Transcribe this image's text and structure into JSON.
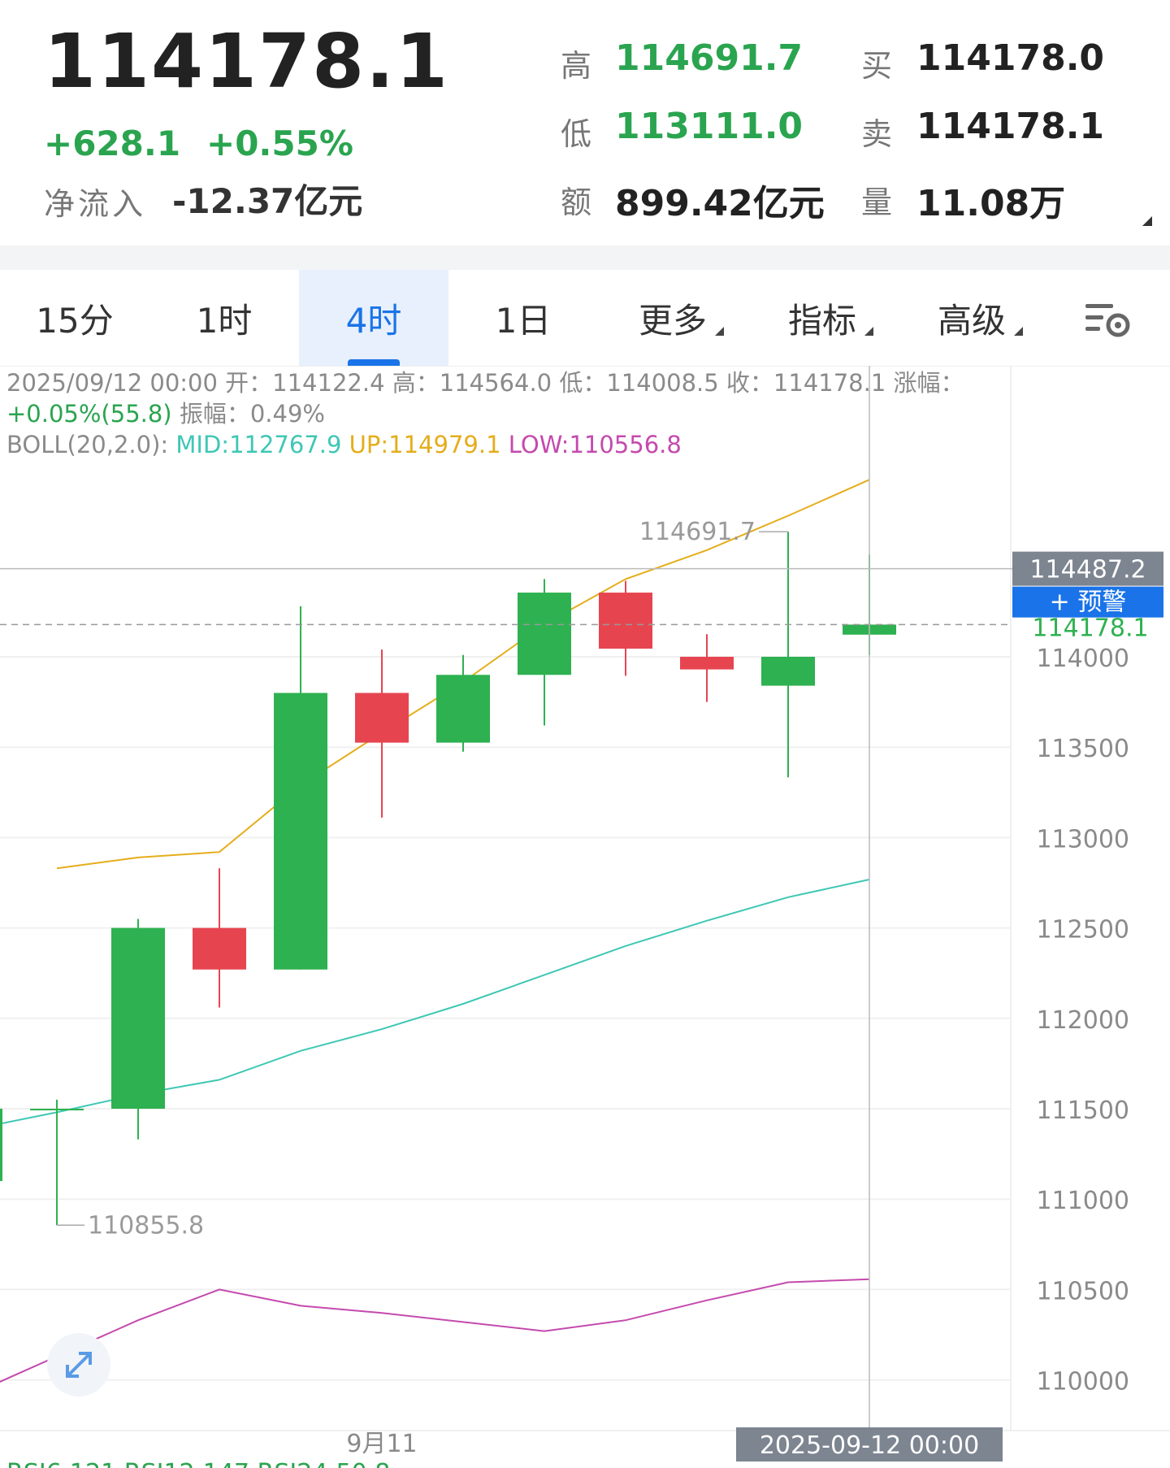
{
  "quote": {
    "price": "114178.1",
    "change": "+628.1",
    "change_pct": "+0.55%",
    "net_inflow_label": "净流入",
    "net_inflow_value": "-12.37亿元",
    "high_label": "高",
    "high_value": "114691.7",
    "low_label": "低",
    "low_value": "113111.0",
    "turnover_label": "额",
    "turnover_value": "899.42亿元",
    "bid_label": "买",
    "bid_value": "114178.0",
    "ask_label": "卖",
    "ask_value": "114178.1",
    "volume_label": "量",
    "volume_value": "11.08万"
  },
  "tabs": [
    {
      "label": "15分"
    },
    {
      "label": "1时"
    },
    {
      "label": "4时"
    },
    {
      "label": "1日"
    },
    {
      "label": "更多"
    },
    {
      "label": "指标"
    },
    {
      "label": "高级"
    }
  ],
  "active_tab": "4时",
  "info": {
    "line1": "2025/09/12 00:00 开：114122.4 高：114564.0 低：114008.5 收：114178.1 涨幅：",
    "line2_change": "+0.05%(55.8)",
    "line2_amp": " 振幅：0.49%",
    "boll_label": "BOLL(20,2.0): ",
    "boll_mid": "MID:112767.9",
    "boll_up": " UP:114979.1",
    "boll_low": " LOW:110556.8"
  },
  "price_tags": {
    "crosshair_value": "114487.2",
    "alert_label": "+ 预警",
    "last_price": "114178.1",
    "max_marker": "114691.7",
    "min_marker": "110855.8"
  },
  "x_labels": {
    "date_tick": "9月11",
    "crosshair_time": "2025-09-12 00:00"
  },
  "footer_partial": "RSI6:121 RSI12:147 RSI24:50.8",
  "colors": {
    "up": "#2eb150",
    "down": "#e64550",
    "boll_up": "#e5ad1b",
    "boll_mid": "#3fc7b4",
    "boll_low": "#c44aae",
    "accent": "#1a73e8"
  },
  "chart_data": {
    "type": "candlestick",
    "y_ticks": [
      "114000",
      "113500",
      "113000",
      "112500",
      "112000",
      "111500",
      "111000",
      "110500",
      "110000"
    ],
    "ylim": [
      109860,
      114000
    ],
    "candles": [
      {
        "open": 111100,
        "close": 111500,
        "high": 111500,
        "low": 111100
      },
      {
        "open": 111500,
        "close": 111500,
        "high": 111550,
        "low": 110855.8
      },
      {
        "open": 111500,
        "close": 112500,
        "high": 112550,
        "low": 111330
      },
      {
        "open": 112500,
        "close": 112270,
        "high": 112830,
        "low": 112060
      },
      {
        "open": 112270,
        "close": 113800,
        "high": 114280,
        "low": 112270
      },
      {
        "open": 113800,
        "close": 113525,
        "high": 114040,
        "low": 113110
      },
      {
        "open": 113525,
        "close": 113900,
        "high": 114010,
        "low": 113475
      },
      {
        "open": 113900,
        "close": 114355,
        "high": 114430,
        "low": 113620
      },
      {
        "open": 114355,
        "close": 114045,
        "high": 114420,
        "low": 113895
      },
      {
        "open": 114000,
        "close": 113930,
        "high": 114125,
        "low": 113750
      },
      {
        "open": 113840,
        "close": 114000,
        "high": 114691.7,
        "low": 113333
      },
      {
        "open": 114122.4,
        "close": 114178.1,
        "high": 114564.0,
        "low": 114008.5
      }
    ],
    "boll_up": [
      null,
      112830,
      112890,
      112920,
      113290,
      113580,
      113860,
      114180,
      114430,
      114590,
      114780,
      114979.1
    ],
    "boll_mid": [
      111390,
      111480,
      111580,
      111660,
      111820,
      111940,
      112080,
      112240,
      112400,
      112540,
      112670,
      112767.9
    ],
    "boll_low": [
      109930,
      110130,
      110330,
      110500,
      110410,
      110370,
      110320,
      110270,
      110330,
      110440,
      110540,
      110556.8
    ]
  }
}
